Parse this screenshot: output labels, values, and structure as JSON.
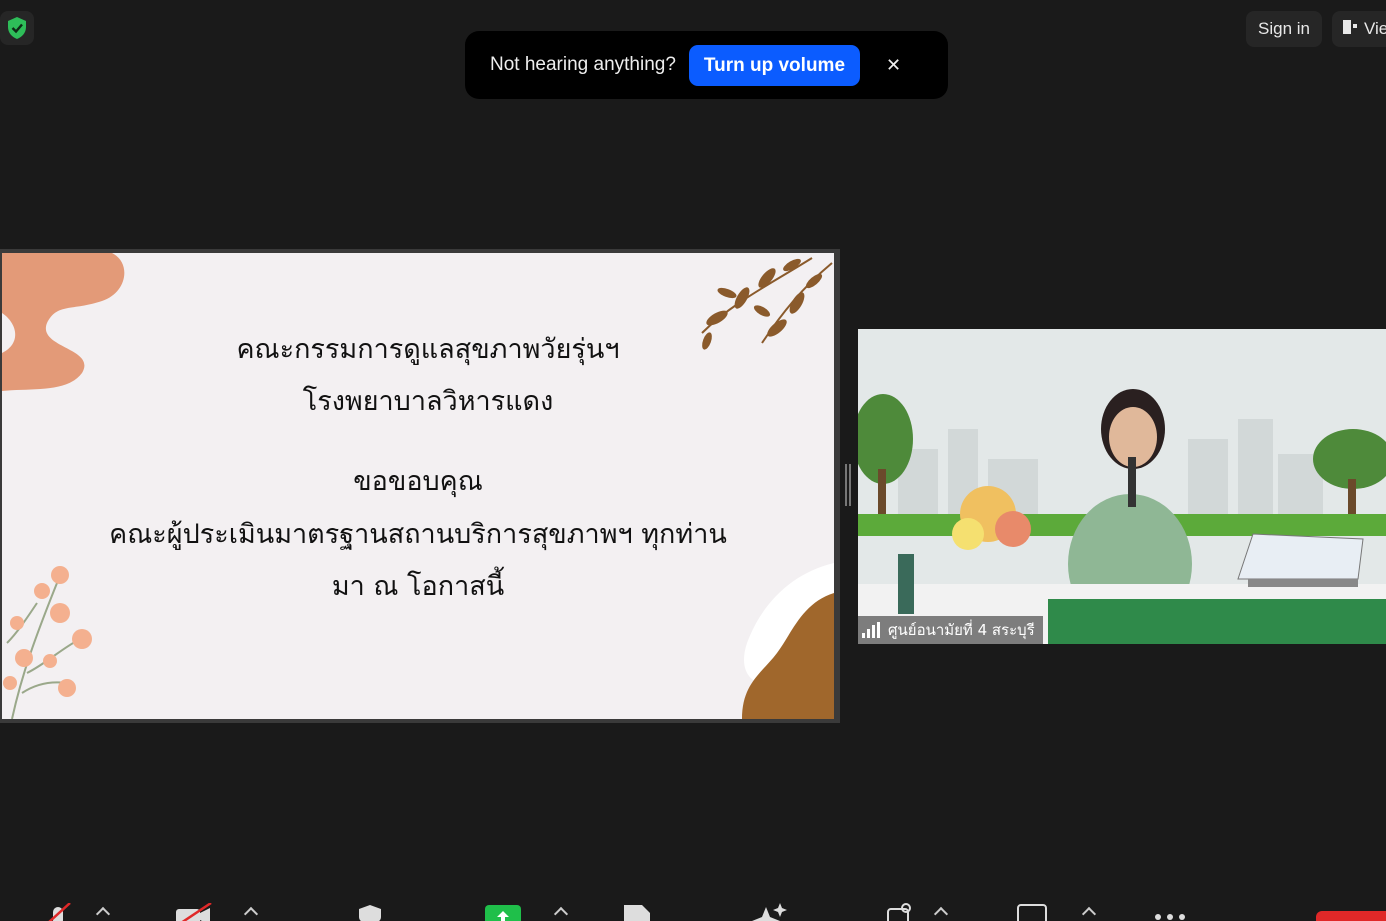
{
  "toast": {
    "message": "Not hearing anything?",
    "action_label": "Turn up volume",
    "close_label": "✕"
  },
  "header": {
    "sign_in_label": "Sign in",
    "view_label": "View"
  },
  "slide": {
    "lines": [
      "คณะกรรมการดูแลสุขภาพวัยรุ่นฯ",
      "โรงพยาบาลวิหารแดง",
      "ขอขอบคุณ",
      "คณะผู้ประเมินมาตรฐานสถานบริการสุขภาพฯ ทุกท่าน",
      "มา ณ โอกาสนี้"
    ]
  },
  "video": {
    "participant_name": "ศูนย์อนามัยที่ 4 สระบุรี"
  },
  "colors": {
    "background": "#1a1a1a",
    "accent": "#0b5cff",
    "slide_orange": "#e39a78",
    "slide_brown": "#8a5a2b",
    "share_icon": "#1fbf4a",
    "end_button": "#e02828"
  }
}
